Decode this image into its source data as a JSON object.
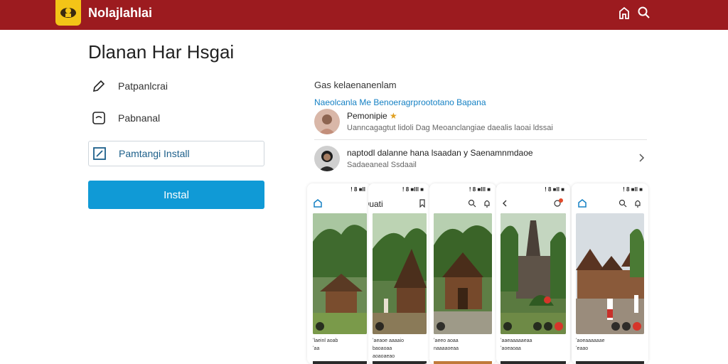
{
  "header": {
    "brand": "Nolajlahlai",
    "accent": "#9c1b1f",
    "logo_color": "#f3c417",
    "icons": [
      "home-outline-icon",
      "search-icon"
    ]
  },
  "main": {
    "title": "Dlanan Har Hsgai",
    "options": [
      {
        "label": "Patpanlcrai",
        "icon": "pencil-icon"
      },
      {
        "label": "Pabnanal",
        "icon": "chat-square-icon"
      },
      {
        "label": "Pamtangi Install",
        "icon": "edit-square-icon"
      }
    ],
    "install_label": "Instal",
    "install_color": "#109ad6"
  },
  "right": {
    "heading": "Gas kelaenanenlam",
    "link": "Naeolcanla Me Benoeragrproototano Bapana",
    "items": [
      {
        "title": "Pemonipie",
        "subtitle": "Uanncagagtut lidoli Dag Meoanclangiae daealis laoai ldssai"
      },
      {
        "title": "naptodl dalanne hana lsaadan y Saenamnmdaoe",
        "subtitle": "Sadaeaneal Ssdaail"
      }
    ]
  },
  "phones": [
    {
      "status": "! 8 ■ll",
      "title": "",
      "caption": "ʻlaeinl aoab\nʻaa"
    },
    {
      "status": "! 8 ■lll ■",
      "title": "Ouati",
      "caption": "ʻaeaoe aaaaio\nbaoaoaa\naoaoaeao"
    },
    {
      "status": "! 8 ■lll ■",
      "title": "",
      "caption": "ʻaeeo aoaa\nnaaaaoeaa"
    },
    {
      "status": "! 8 ■ll ■",
      "title": "",
      "caption": "ʻaaeaaaaaeaa\nʻaoeaoaa"
    },
    {
      "status": "! 8 ■ll ■",
      "title": "",
      "caption": "ʻaoeaaaaaae\nʻeaao"
    }
  ]
}
